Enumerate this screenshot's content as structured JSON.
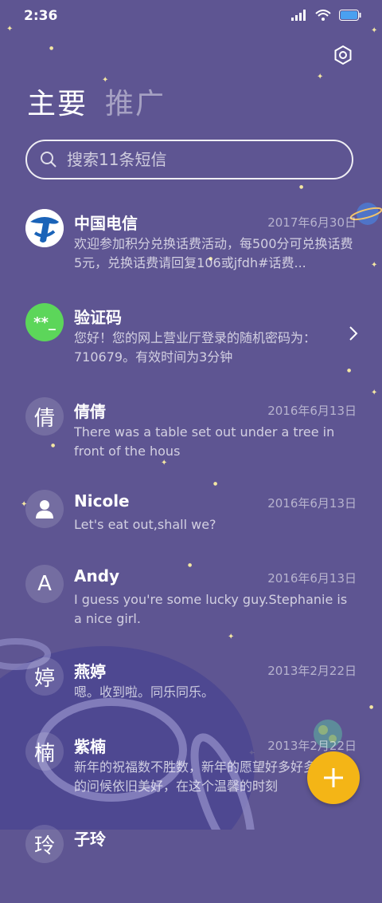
{
  "status_bar": {
    "time": "2:36"
  },
  "tabs": [
    {
      "label": "主要",
      "active": true
    },
    {
      "label": "推广",
      "active": false
    }
  ],
  "search": {
    "placeholder": "搜索11条短信"
  },
  "conversations": [
    {
      "name": "中国电信",
      "date": "2017年6月30日",
      "preview": "欢迎参加积分兑换话费活动，每500分可兑换话费5元，兑换话费请回复106或jfdh#话费...",
      "avatar_text": "",
      "avatar_icon": "china-telecom-logo"
    },
    {
      "name": "验证码",
      "date": "",
      "preview": "您好！您的网上营业厅登录的随机密码为：710679。有效时间为3分钟",
      "avatar_text": "**_",
      "avatar_icon": "verification-code-icon"
    },
    {
      "name": "倩倩",
      "date": "2016年6月13日",
      "preview": "There was a table set out under a tree in front of the hous",
      "avatar_text": "倩"
    },
    {
      "name": "Nicole",
      "date": "2016年6月13日",
      "preview": "Let's eat out,shall we?",
      "avatar_text": "",
      "avatar_icon": "person-icon"
    },
    {
      "name": "Andy",
      "date": "2016年6月13日",
      "preview": "I guess you're some lucky guy.Stephanie is a nice girl.",
      "avatar_text": "A"
    },
    {
      "name": "燕婷",
      "date": "2013年2月22日",
      "preview": "嗯。收到啦。同乐同乐。",
      "avatar_text": "婷"
    },
    {
      "name": "紫楠",
      "date": "2013年2月22日",
      "preview": "新年的祝福数不胜数，新年的愿望好多好多，新年的问候依旧美好，在这个温馨的时刻",
      "avatar_text": "楠"
    },
    {
      "name": "子玲",
      "date": "",
      "preview": "",
      "avatar_text": "玲"
    }
  ],
  "colors": {
    "background": "#5e5592",
    "fab": "#f4b516",
    "verify_green": "#5cd65a",
    "telecom_blue": "#1a63b8"
  },
  "icons": {
    "settings": "settings-ring-icon",
    "compose": "plus-icon",
    "search": "search-icon"
  }
}
